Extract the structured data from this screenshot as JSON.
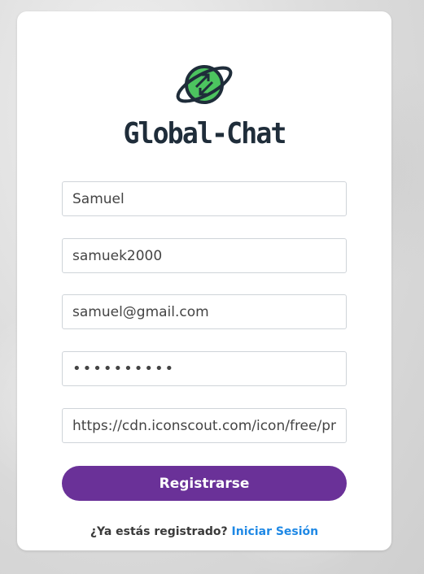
{
  "brand": {
    "name": "Global-Chat",
    "icon": "rotating-globe-orbit-icon",
    "colors": {
      "ring": "#1f2d3a",
      "globe": "#4cc45f",
      "text": "#1f2d3a"
    }
  },
  "form": {
    "name_value": "Samuel",
    "username_value": "samuek2000",
    "email_value": "samuel@gmail.com",
    "password_value": "••••••••••",
    "avatar_url_value": "https://cdn.iconscout.com/icon/free/png-",
    "submit_label": "Registrarse",
    "submit_color": "#6a3198"
  },
  "footer": {
    "prompt": "¿Ya estás registrado?",
    "link_label": "Iniciar Sesión",
    "link_color": "#1e88e5"
  }
}
